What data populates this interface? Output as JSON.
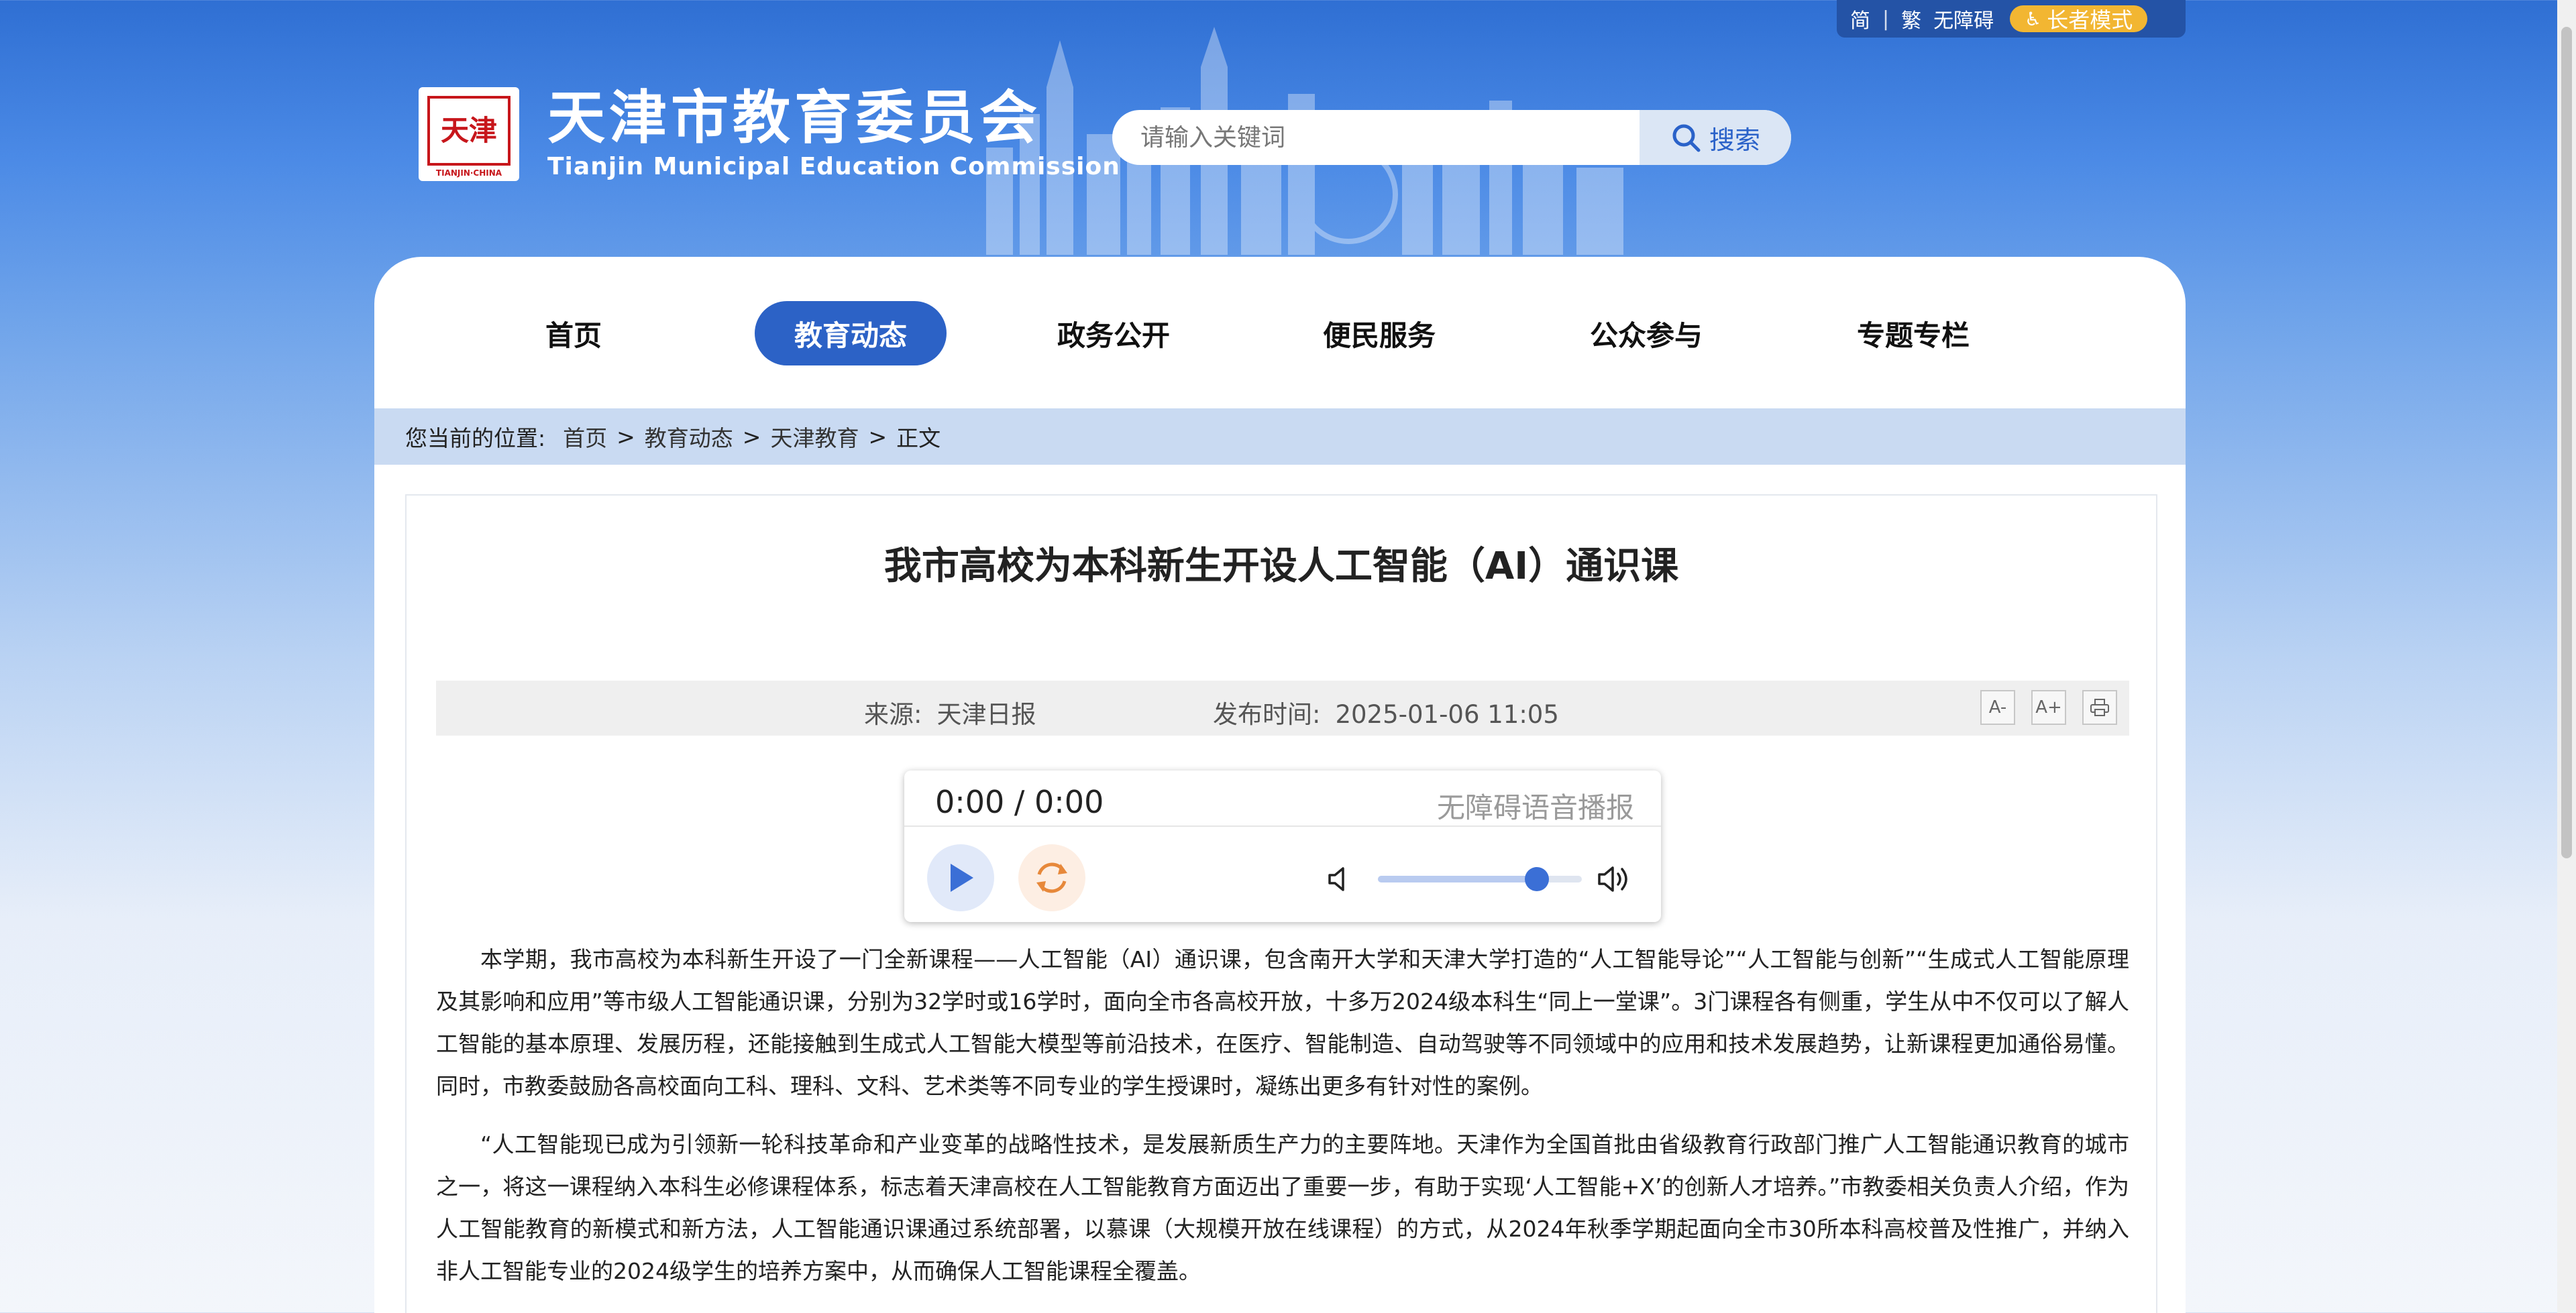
{
  "topbar": {
    "simplified": "简",
    "separator": "|",
    "traditional": "繁",
    "accessible": "无障碍",
    "elder_mode": "长者模式"
  },
  "logo": {
    "seal_text": "天津",
    "seal_en": "TIANJIN·CHINA",
    "title_cn": "天津市教育委员会",
    "title_en": "Tianjin Municipal Education Commission"
  },
  "search": {
    "placeholder": "请输入关键词",
    "button_label": "搜索"
  },
  "nav": {
    "items": [
      {
        "label": "首页"
      },
      {
        "label": "教育动态"
      },
      {
        "label": "政务公开"
      },
      {
        "label": "便民服务"
      },
      {
        "label": "公众参与"
      },
      {
        "label": "专题专栏"
      }
    ],
    "active_index": 1
  },
  "breadcrumb": {
    "label": "您当前的位置:",
    "items": [
      "首页",
      "教育动态",
      "天津教育",
      "正文"
    ],
    "separator": ">"
  },
  "article": {
    "title": "我市高校为本科新生开设人工智能（AI）通识课",
    "source_label": "来源:",
    "source": "天津日报",
    "time_label": "发布时间:",
    "time": "2025-01-06 11:05",
    "tools": {
      "font_decrease": "A-",
      "font_increase": "A+"
    },
    "paragraphs": [
      "本学期，我市高校为本科新生开设了一门全新课程——人工智能（AI）通识课，包含南开大学和天津大学打造的“人工智能导论”“人工智能与创新”“生成式人工智能原理及其影响和应用”等市级人工智能通识课，分别为32学时或16学时，面向全市各高校开放，十多万2024级本科生“同上一堂课”。3门课程各有侧重，学生从中不仅可以了解人工智能的基本原理、发展历程，还能接触到生成式人工智能大模型等前沿技术，在医疗、智能制造、自动驾驶等不同领域中的应用和技术发展趋势，让新课程更加通俗易懂。同时，市教委鼓励各高校面向工科、理科、文科、艺术类等不同专业的学生授课时，凝练出更多有针对性的案例。",
      "“人工智能现已成为引领新一轮科技革命和产业变革的战略性技术，是发展新质生产力的主要阵地。天津作为全国首批由省级教育行政部门推广人工智能通识教育的城市之一，将这一课程纳入本科生必修课程体系，标志着天津高校在人工智能教育方面迈出了重要一步，有助于实现‘人工智能+X’的创新人才培养。”市教委相关负责人介绍，作为人工智能教育的新模式和新方法，人工智能通识课通过系统部署，以慕课（大规模开放在线课程）的方式，从2024年秋季学期起面向全市30所本科高校普及性推广，并纳入非人工智能专业的2024级学生的培养方案中，从而确保人工智能课程全覆盖。"
    ]
  },
  "player": {
    "time_display": "0:00 / 0:00",
    "label": "无障碍语音播报",
    "volume": 0.78
  },
  "colors": {
    "nav_active": "#2c62c6",
    "elder_button": "#f2b632",
    "breadcrumb_bg": "#c9daf2",
    "seal_red": "#c7161b"
  }
}
